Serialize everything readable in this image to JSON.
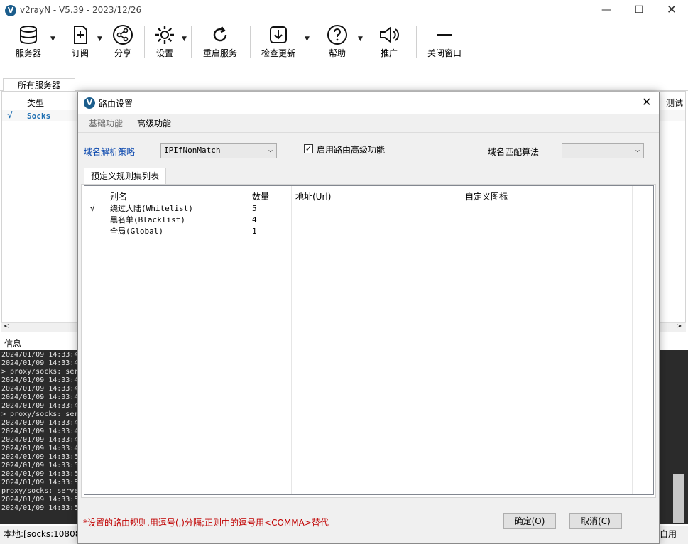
{
  "window": {
    "title": "v2rayN - V5.39 - 2023/12/26",
    "logo": "V"
  },
  "toolbar": {
    "servers": "服务器",
    "subscribe": "订阅",
    "share": "分享",
    "settings": "设置",
    "restart": "重启服务",
    "check_update": "检查更新",
    "help": "帮助",
    "promote": "推广",
    "close_window": "关闭窗口"
  },
  "main": {
    "tab_all": "所有服务器",
    "col_type": "类型",
    "col_test": "测试",
    "row_type": "Socks",
    "info_label": "信息",
    "status_local": "本地:[socks:10808",
    "status_right": "自用"
  },
  "log_lines": [
    "2024/01/09 14:33:4",
    "2024/01/09 14:33:4",
    "> proxy/socks: ser",
    "2024/01/09 14:33:4",
    "2024/01/09 14:33:4",
    "2024/01/09 14:33:4",
    "2024/01/09 14:33:4",
    "> proxy/socks: ser",
    "2024/01/09 14:33:4",
    "2024/01/09 14:33:4",
    "2024/01/09 14:33:4",
    "2024/01/09 14:33:4",
    "2024/01/09 14:33:5",
    "2024/01/09 14:33:5",
    "2024/01/09 14:33:5",
    "2024/01/09 14:33:5",
    "proxy/socks: serve",
    "2024/01/09 14:33:5",
    "2024/01/09 14:33:5"
  ],
  "dialog": {
    "title": "路由设置",
    "tab_basic": "基础功能",
    "tab_advanced": "高级功能",
    "domain_strategy_label": "域名解析策略",
    "domain_strategy_value": "IPIfNonMatch",
    "enable_advanced_label": "启用路由高级功能",
    "match_algo_label": "域名匹配算法",
    "match_algo_value": "",
    "ruleset_tab": "预定义规则集列表",
    "columns": {
      "alias": "别名",
      "count": "数量",
      "url": "地址(Url)",
      "icon": "自定义图标"
    },
    "rules": [
      {
        "check": "√",
        "alias": "绕过大陆(Whitelist)",
        "count": "5"
      },
      {
        "check": "",
        "alias": "黑名单(Blacklist)",
        "count": "4"
      },
      {
        "check": "",
        "alias": "全局(Global)",
        "count": "1"
      }
    ],
    "footer_note": "*设置的路由规则,用逗号(,)分隔;正则中的逗号用<COMMA>替代",
    "ok": "确定(O)",
    "cancel": "取消(C)"
  },
  "colors": {
    "accent_link": "#0645ad",
    "note_red": "#c00000",
    "check_blue": "#1f6fb2"
  }
}
